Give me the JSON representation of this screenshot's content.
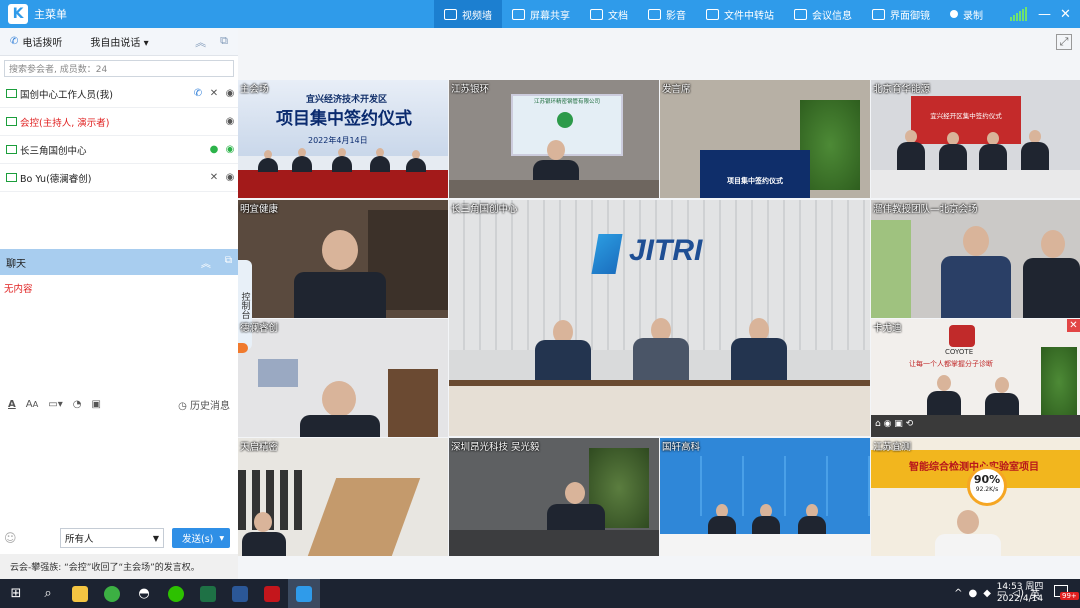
{
  "app": {
    "title": "主菜单",
    "logo": "K"
  },
  "tabs": [
    {
      "label": "视频墙",
      "icon": "video-wall-icon",
      "active": true
    },
    {
      "label": "屏幕共享",
      "icon": "screen-share-icon"
    },
    {
      "label": "文档",
      "icon": "document-icon"
    },
    {
      "label": "影音",
      "icon": "media-icon"
    },
    {
      "label": "文件中转站",
      "icon": "folder-icon"
    },
    {
      "label": "会议信息",
      "icon": "info-icon"
    },
    {
      "label": "界面御镜",
      "icon": "layout-icon"
    },
    {
      "label": "录制",
      "icon": "record-icon"
    }
  ],
  "window_controls": {
    "minimize": "—",
    "close": "✕"
  },
  "participants_panel": {
    "phone_invite": "电话拨听",
    "free_speech": "我自由说话",
    "search_placeholder": "搜索参会者, 成员数：24",
    "members": [
      {
        "name": "国创中心工作人员(我)",
        "red": false
      },
      {
        "name": "会控(主持人, 演示者)",
        "red": true
      },
      {
        "name": "长三角国创中心",
        "red": false
      },
      {
        "name": "Bo Yu(德澜睿创)",
        "red": false
      }
    ]
  },
  "chat": {
    "title": "聊天",
    "empty": "无内容",
    "history": "历史消息",
    "recipient": "所有人",
    "send": "发送(s)",
    "notice": "云会-攀强族: “会控”收回了“主会场”的发言权。"
  },
  "control_tab": "控制台",
  "tiles": [
    {
      "label": "主会场",
      "sign_org": "宜兴经济技术开发区",
      "sign_title": "项目集中签约仪式",
      "sign_date": "2022年4月14日"
    },
    {
      "label": "江苏银环",
      "sign_text": "江苏银环精密钢管有限公司"
    },
    {
      "label": "发言席",
      "sign_text": "项目集中签约仪式"
    },
    {
      "label": "北京育华能源",
      "sign_text": "宜兴经开区集中签约仪式"
    },
    {
      "label": "明宜健康"
    },
    {
      "label": "长三角国创中心",
      "logo_text": "JITRI"
    },
    {
      "label": "溜伟教授团队—北京会场"
    },
    {
      "label": "德澜睿创"
    },
    {
      "label": "卡尤迪",
      "brand": "COYOTE",
      "slogan": "让每一个人都掌握分子诊断"
    },
    {
      "label": "天启精密"
    },
    {
      "label": "深圳昂光科技 吴光毅"
    },
    {
      "label": "国轩高科"
    },
    {
      "label": "江苏宜测",
      "banner": "智能综合检测中心实验室项目",
      "overlay_pct": "90%",
      "overlay_speed": "92.2K/s"
    }
  ],
  "taskbar": {
    "time": "14:53 周四",
    "date": "2022/4/14",
    "ime": "英",
    "notif_badge": "99+"
  }
}
